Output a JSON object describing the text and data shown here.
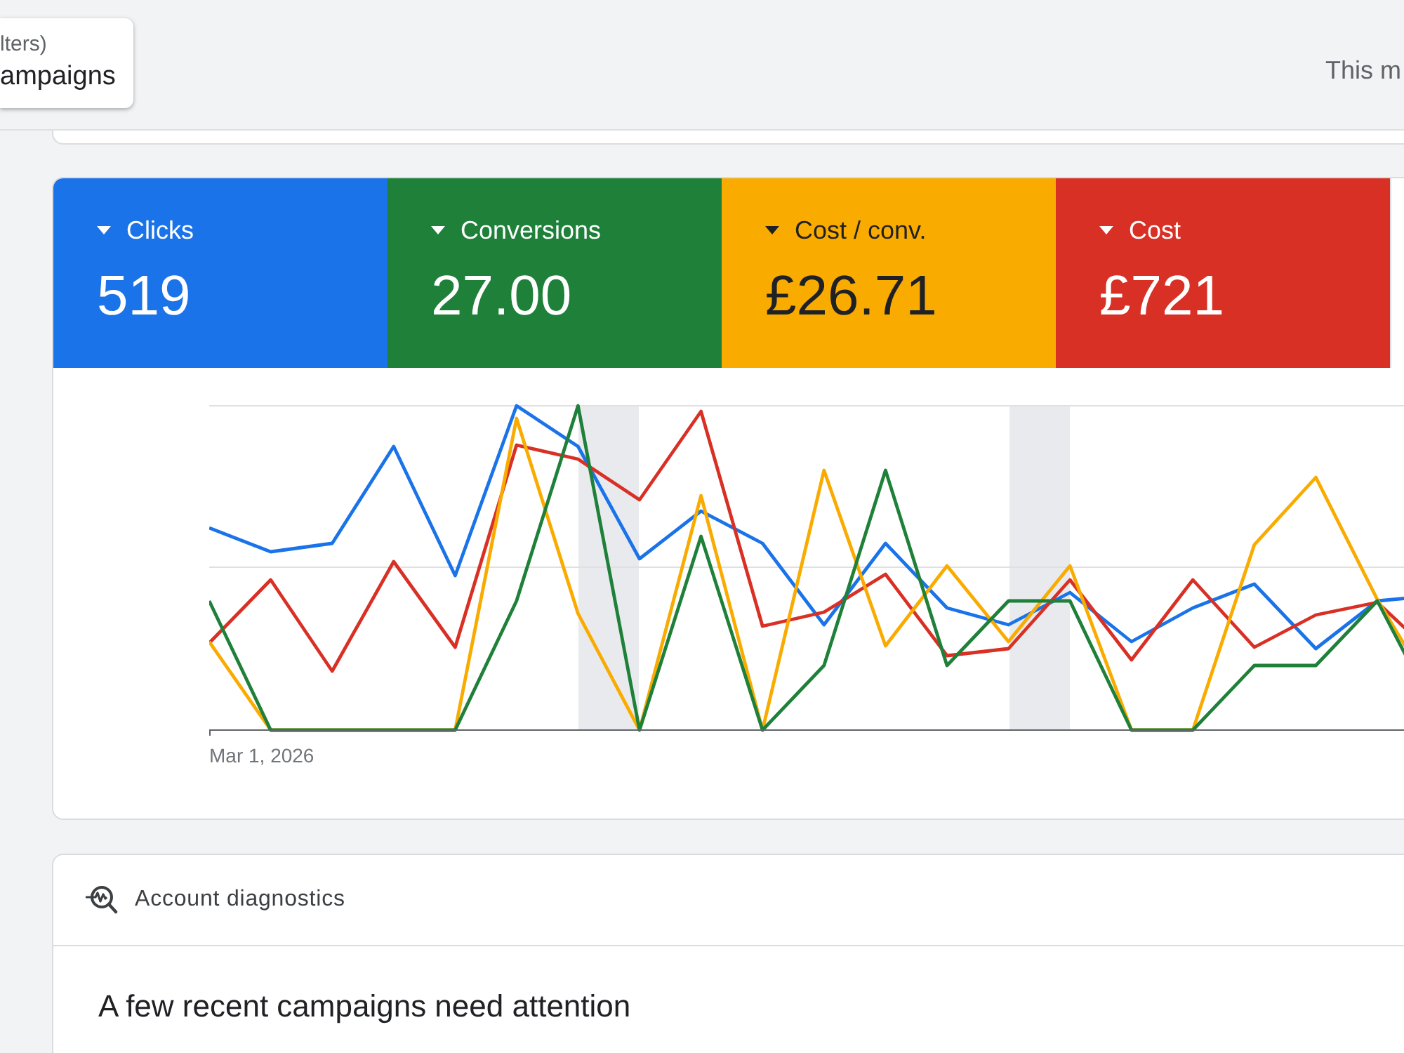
{
  "selector": {
    "caption": "lters)",
    "title": "ampaigns"
  },
  "date_range": "This m",
  "metrics": [
    {
      "label": "Clicks",
      "value": "519",
      "color": "#1a73e8"
    },
    {
      "label": "Conversions",
      "value": "27.00",
      "color": "#1e8039"
    },
    {
      "label": "Cost / conv.",
      "value": "£26.71",
      "color": "#f9ab00"
    },
    {
      "label": "Cost",
      "value": "£721",
      "color": "#d93025"
    }
  ],
  "chart": {
    "x_label": "Mar 1, 2026"
  },
  "diagnostics": {
    "title": "Account diagnostics",
    "heading": "A few recent campaigns need attention"
  }
}
